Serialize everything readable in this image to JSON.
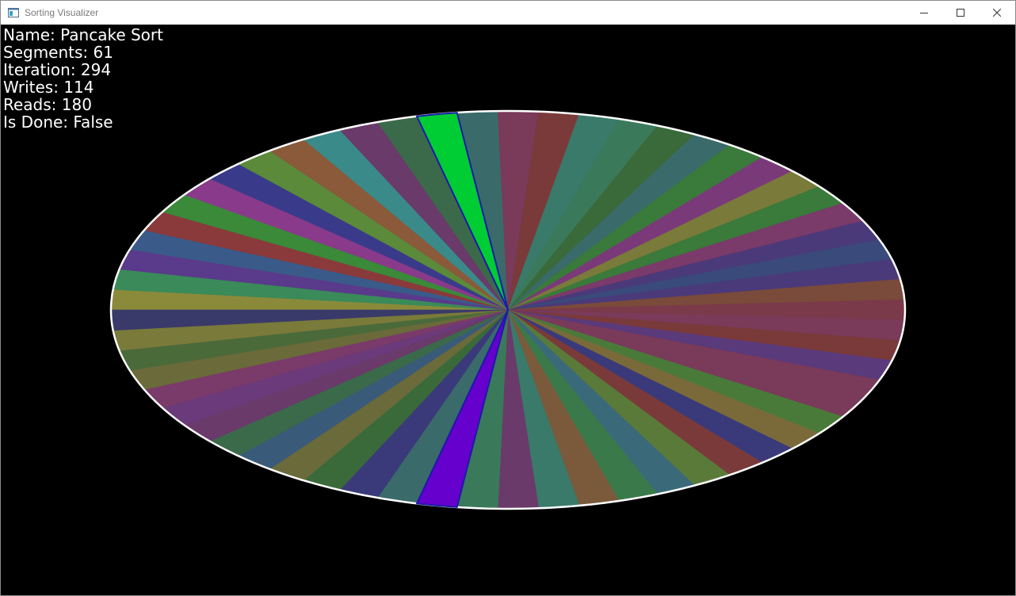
{
  "window": {
    "title": "Sorting Visualizer",
    "icon": "app-window-icon",
    "controls": [
      "minimize-icon",
      "maximize-icon",
      "close-icon"
    ]
  },
  "stats": {
    "name": "Name: Pancake Sort",
    "segments": "Segments: 61",
    "iteration": "Iteration: 294",
    "writes": "Writes: 114",
    "reads": "Reads: 180",
    "is_done": "Is Done: False"
  },
  "chart_data": {
    "type": "pie",
    "segment_count": 61,
    "start_angle_deg": 180,
    "outline_color": "#ffffff",
    "highlight_outline_color": "#1a1aaa",
    "slice_colors": [
      "#8a8a3a",
      "#3a8a5a",
      "#5a3a8a",
      "#3a5a8a",
      "#8a3a3a",
      "#3a8a3a",
      "#8a3a8a",
      "#3a3a8a",
      "#5a8a3a",
      "#8a5a3a",
      "#3a8a8a",
      "#6a3a6a",
      "#3a6a4a",
      "#00cc33",
      "#3a6a6a",
      "#7a3a5a",
      "#7a3a3a",
      "#3a7a6a",
      "#3a7a5a",
      "#3a6a3a",
      "#3a6a6a",
      "#3a7a3a",
      "#7a3a7a",
      "#7a7a3a",
      "#3a7a3a",
      "#7a3a6a",
      "#4a3a7a",
      "#3a4a7a",
      "#4a3a7a",
      "#7a4a3a",
      "#7a3a4a",
      "#7a3a5a",
      "#7a3a3a",
      "#5a3a7a",
      "#7a3a5a",
      "#7a3a5a",
      "#4a7a3a",
      "#7a6a3a",
      "#3a3a7a",
      "#7a3a3a",
      "#5a7a3a",
      "#3a6a7a",
      "#3a7a4a",
      "#7a5a3a",
      "#3a7a6a",
      "#6a3a6a",
      "#3a7a5a",
      "#6600cc",
      "#3a6a6a",
      "#3a3a7a",
      "#3a6a3a",
      "#6a6a3a",
      "#3a5a7a",
      "#3a6a4a",
      "#6a3a6a",
      "#6a3a7a",
      "#7a3a6a",
      "#6a6a3a",
      "#4a6a3a",
      "#7a7a3a",
      "#3a3a6a"
    ],
    "highlighted_slices": [
      13,
      47
    ],
    "highlight_colors": {
      "13": "#00cc33",
      "47": "#6600cc"
    }
  }
}
